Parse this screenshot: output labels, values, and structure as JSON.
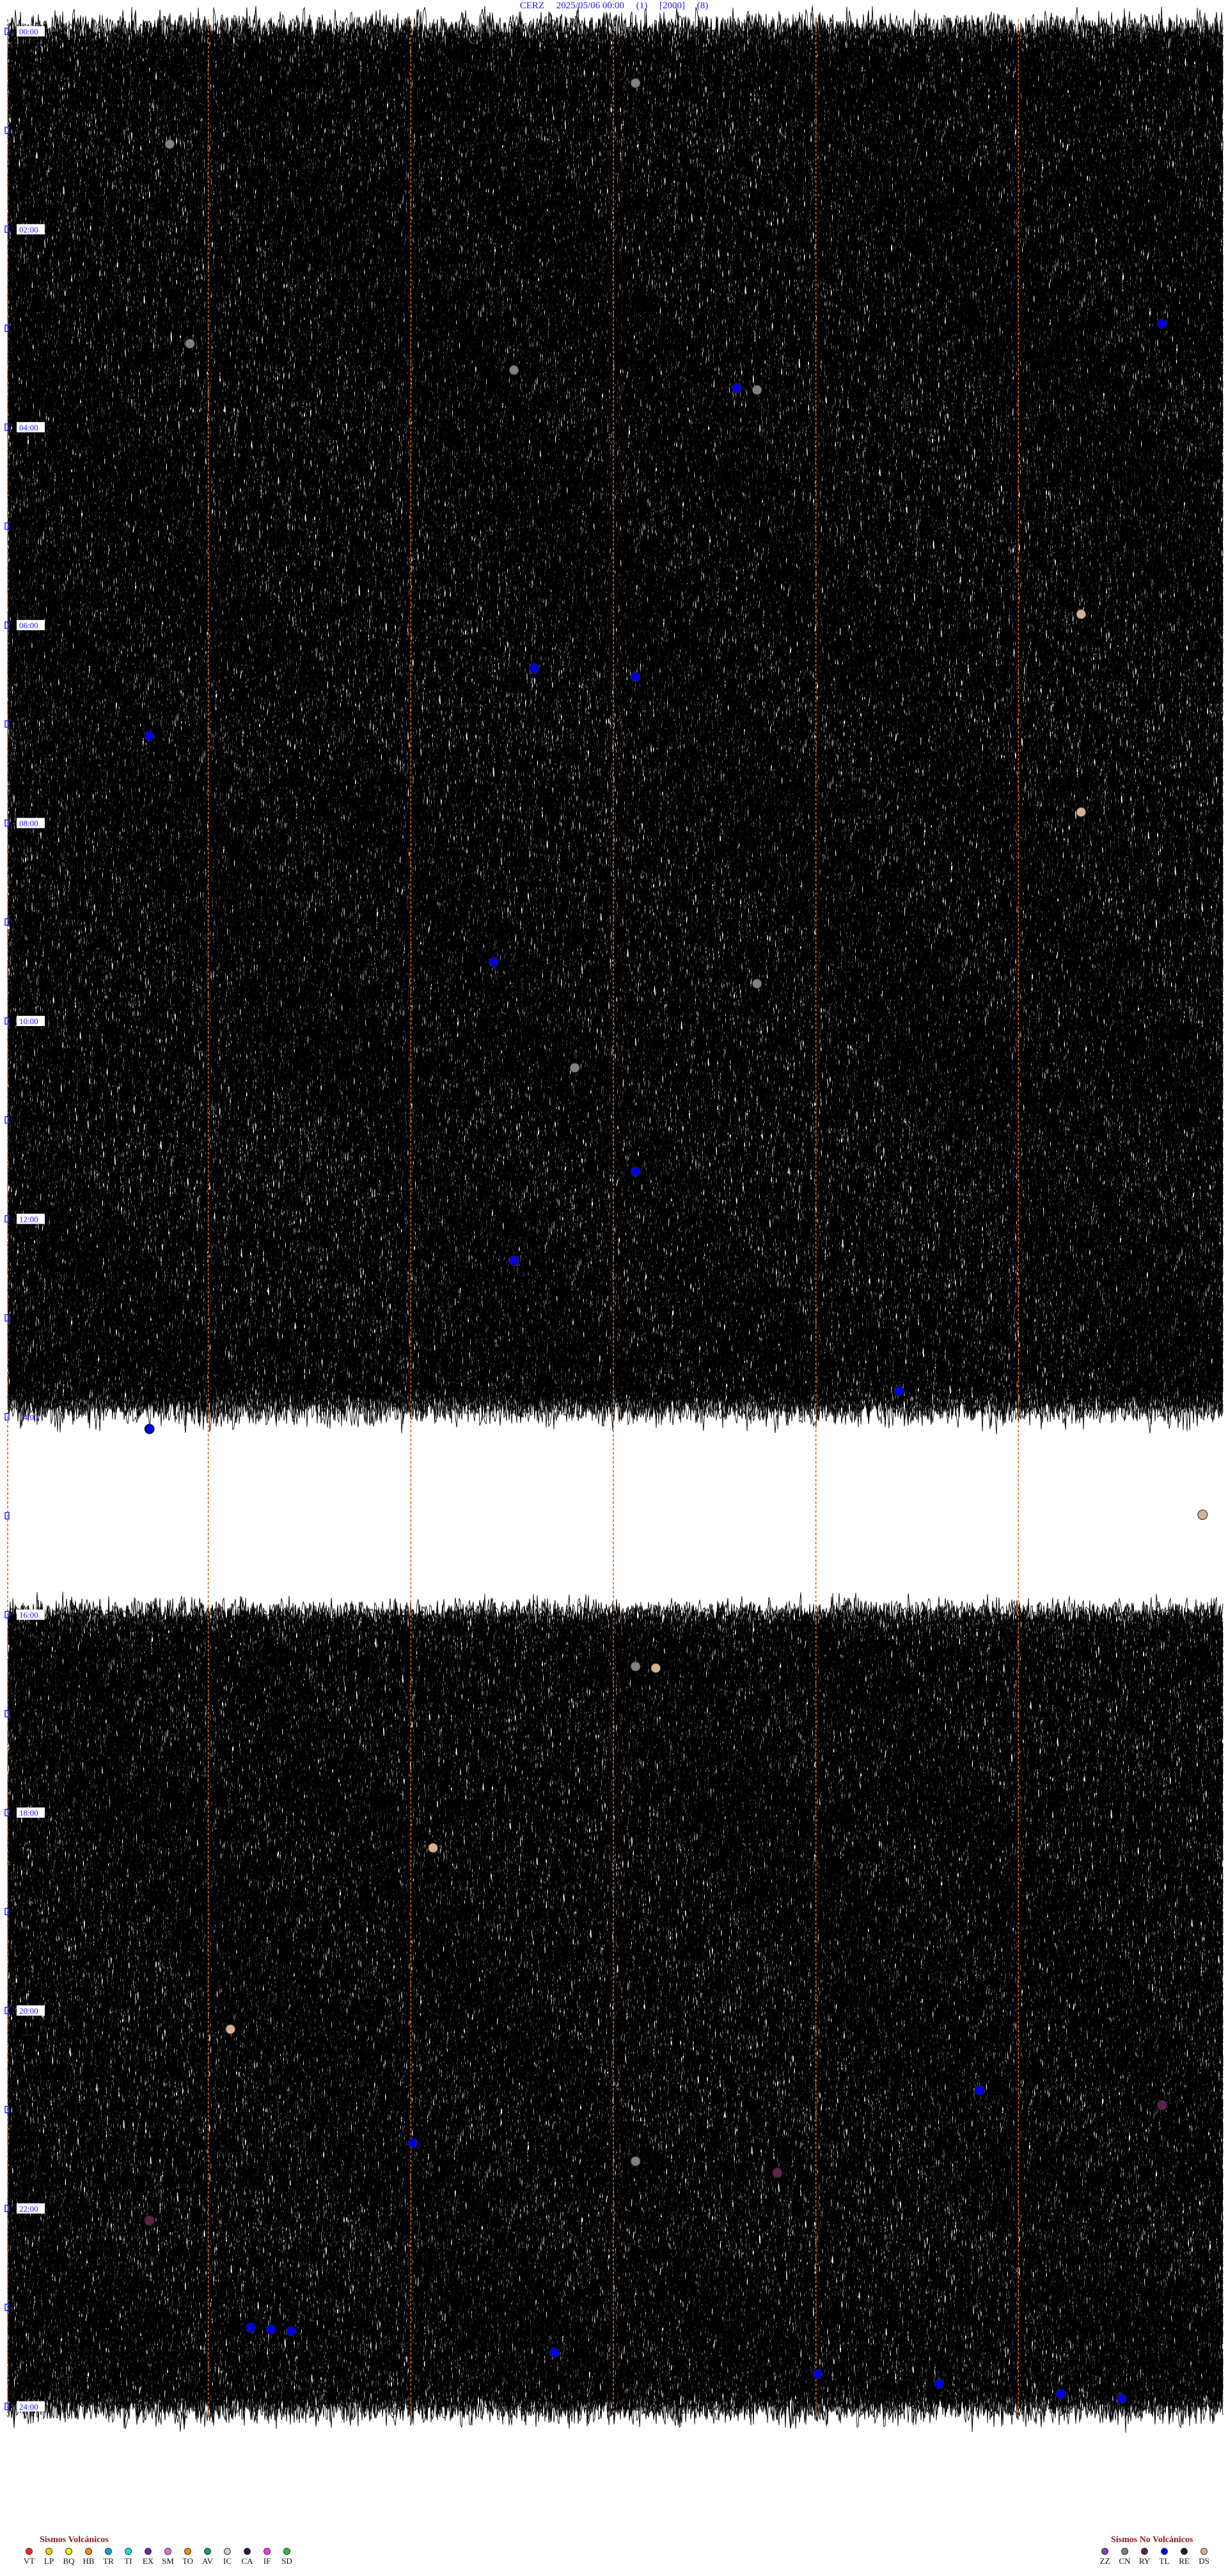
{
  "title": "CERZ     2025/05/06 00:00     (1)     [2000]     (8)",
  "chart_data": {
    "type": "helicorder",
    "title": "CERZ     2025/05/06 00:00     (1)     [2000]     (8)",
    "station": "CERZ",
    "date": "2025/05/06",
    "start_time": "00:00",
    "line_labels": [
      "00:00",
      "02:00",
      "04:00",
      "06:00",
      "08:00",
      "10:00",
      "12:00",
      "14:00",
      "16:00",
      "18:00",
      "20:00",
      "22:00",
      "24:00"
    ],
    "gap_hours": [
      [
        13.9,
        16.0
      ]
    ],
    "events": [
      {
        "time": "00:31",
        "type": "CN"
      },
      {
        "time": "01:08",
        "type": "CN"
      },
      {
        "time": "02:57",
        "type": "TL"
      },
      {
        "time": "03:09",
        "type": "CN"
      },
      {
        "time": "03:25",
        "type": "CN"
      },
      {
        "time": "03:36",
        "type": "TL"
      },
      {
        "time": "03:37",
        "type": "CN"
      },
      {
        "time": "05:53",
        "type": "DS"
      },
      {
        "time": "06:26",
        "type": "TL"
      },
      {
        "time": "06:31",
        "type": "TL"
      },
      {
        "time": "07:07",
        "type": "TL"
      },
      {
        "time": "07:53",
        "type": "DS"
      },
      {
        "time": "09:37",
        "type": "CN"
      },
      {
        "time": "09:24",
        "type": "TL"
      },
      {
        "time": "10:28",
        "type": "CN"
      },
      {
        "time": "11:31",
        "type": "TL"
      },
      {
        "time": "12:25",
        "type": "TL"
      },
      {
        "time": "14:07",
        "type": "TL"
      },
      {
        "time": "13:44",
        "type": "TL"
      },
      {
        "time": "14:59",
        "type": "DS"
      },
      {
        "time": "16:32",
        "type": "DS"
      },
      {
        "time": "16:31",
        "type": "CN"
      },
      {
        "time": "18:21",
        "type": "DS"
      },
      {
        "time": "20:11",
        "type": "DS"
      },
      {
        "time": "20:48",
        "type": "TL"
      },
      {
        "time": "20:57",
        "type": "RY"
      },
      {
        "time": "21:20",
        "type": "TL"
      },
      {
        "time": "21:31",
        "type": "CN"
      },
      {
        "time": "21:38",
        "type": "RY"
      },
      {
        "time": "22:07",
        "type": "RY"
      },
      {
        "time": "23:12",
        "type": "TL"
      },
      {
        "time": "23:13",
        "type": "TL"
      },
      {
        "time": "23:14",
        "type": "TL"
      },
      {
        "time": "23:27",
        "type": "TL"
      },
      {
        "time": "23:40",
        "type": "TL"
      },
      {
        "time": "23:46",
        "type": "TL"
      },
      {
        "time": "23:52",
        "type": "TL"
      },
      {
        "time": "23:55",
        "type": "TL"
      }
    ],
    "grid": true
  },
  "legend": {
    "volcanic_title": "Sismos Volcánicos",
    "volcanic": [
      {
        "code": "VT",
        "color": "#ff2020"
      },
      {
        "code": "LP",
        "color": "#ffd000"
      },
      {
        "code": "BQ",
        "color": "#f5f500"
      },
      {
        "code": "HB",
        "color": "#ff8c00"
      },
      {
        "code": "TR",
        "color": "#00a2e8"
      },
      {
        "code": "TI",
        "color": "#00e5e5"
      },
      {
        "code": "EX",
        "color": "#6b2aa0"
      },
      {
        "code": "SM",
        "color": "#e070e0"
      },
      {
        "code": "TO",
        "color": "#f08c00"
      },
      {
        "code": "AV",
        "color": "#00a080"
      },
      {
        "code": "IC",
        "color": "#d0d0d0"
      },
      {
        "code": "CA",
        "color": "#301040"
      },
      {
        "code": "IF",
        "color": "#ff30ff"
      },
      {
        "code": "SD",
        "color": "#30c030"
      }
    ],
    "nonvolcanic_title": "Sismos No Volcánicos",
    "nonvolcanic": [
      {
        "code": "ZZ",
        "color": "#8040c0"
      },
      {
        "code": "CN",
        "color": "#808080"
      },
      {
        "code": "RY",
        "color": "#602050"
      },
      {
        "code": "TL",
        "color": "#0000e0"
      },
      {
        "code": "RE",
        "color": "#202020"
      },
      {
        "code": "DS",
        "color": "#d8b090"
      }
    ]
  }
}
